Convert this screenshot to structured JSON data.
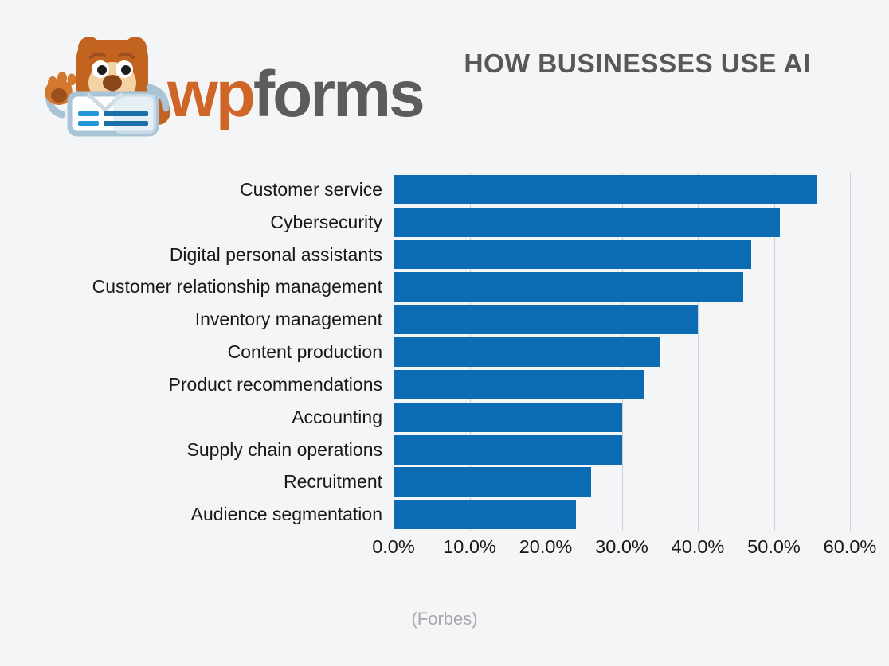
{
  "brand": {
    "logo_icon": "wpforms-bear-mascot-icon",
    "wordmark_wp": "wp",
    "wordmark_forms": "forms",
    "wp_color": "#cf6526",
    "forms_color": "#5c5c5c"
  },
  "header": {
    "title": "HOW BUSINESSES USE AI",
    "title_color": "#58585a"
  },
  "source": {
    "text": "(Forbes)",
    "color": "#a7a9ac"
  },
  "colors": {
    "background": "#f4f5f6",
    "bar": "#0b6cb4",
    "gridline": "#cdcfd2",
    "label": "#17181a"
  },
  "chart_data": {
    "type": "bar",
    "orientation": "horizontal",
    "title": "HOW BUSINESSES USE AI",
    "xlabel": "",
    "ylabel": "",
    "xlim": [
      0,
      60
    ],
    "xticks": [
      0,
      10,
      20,
      30,
      40,
      50,
      60
    ],
    "xtick_labels": [
      "0.0%",
      "10.0%",
      "20.0%",
      "30.0%",
      "40.0%",
      "50.0%",
      "60.0%"
    ],
    "grid": true,
    "grid_axis": "x",
    "legend": false,
    "annotation": "(Forbes)",
    "unit": "%",
    "categories": [
      "Customer service",
      "Cybersecurity",
      "Digital personal assistants",
      "Customer relationship management",
      "Inventory management",
      "Content production",
      "Product recommendations",
      "Accounting",
      "Supply chain operations",
      "Recruitment",
      "Audience segmentation"
    ],
    "values": [
      55.6,
      50.8,
      47.0,
      46.0,
      40.0,
      35.0,
      33.0,
      30.0,
      30.0,
      26.0,
      24.0
    ]
  }
}
